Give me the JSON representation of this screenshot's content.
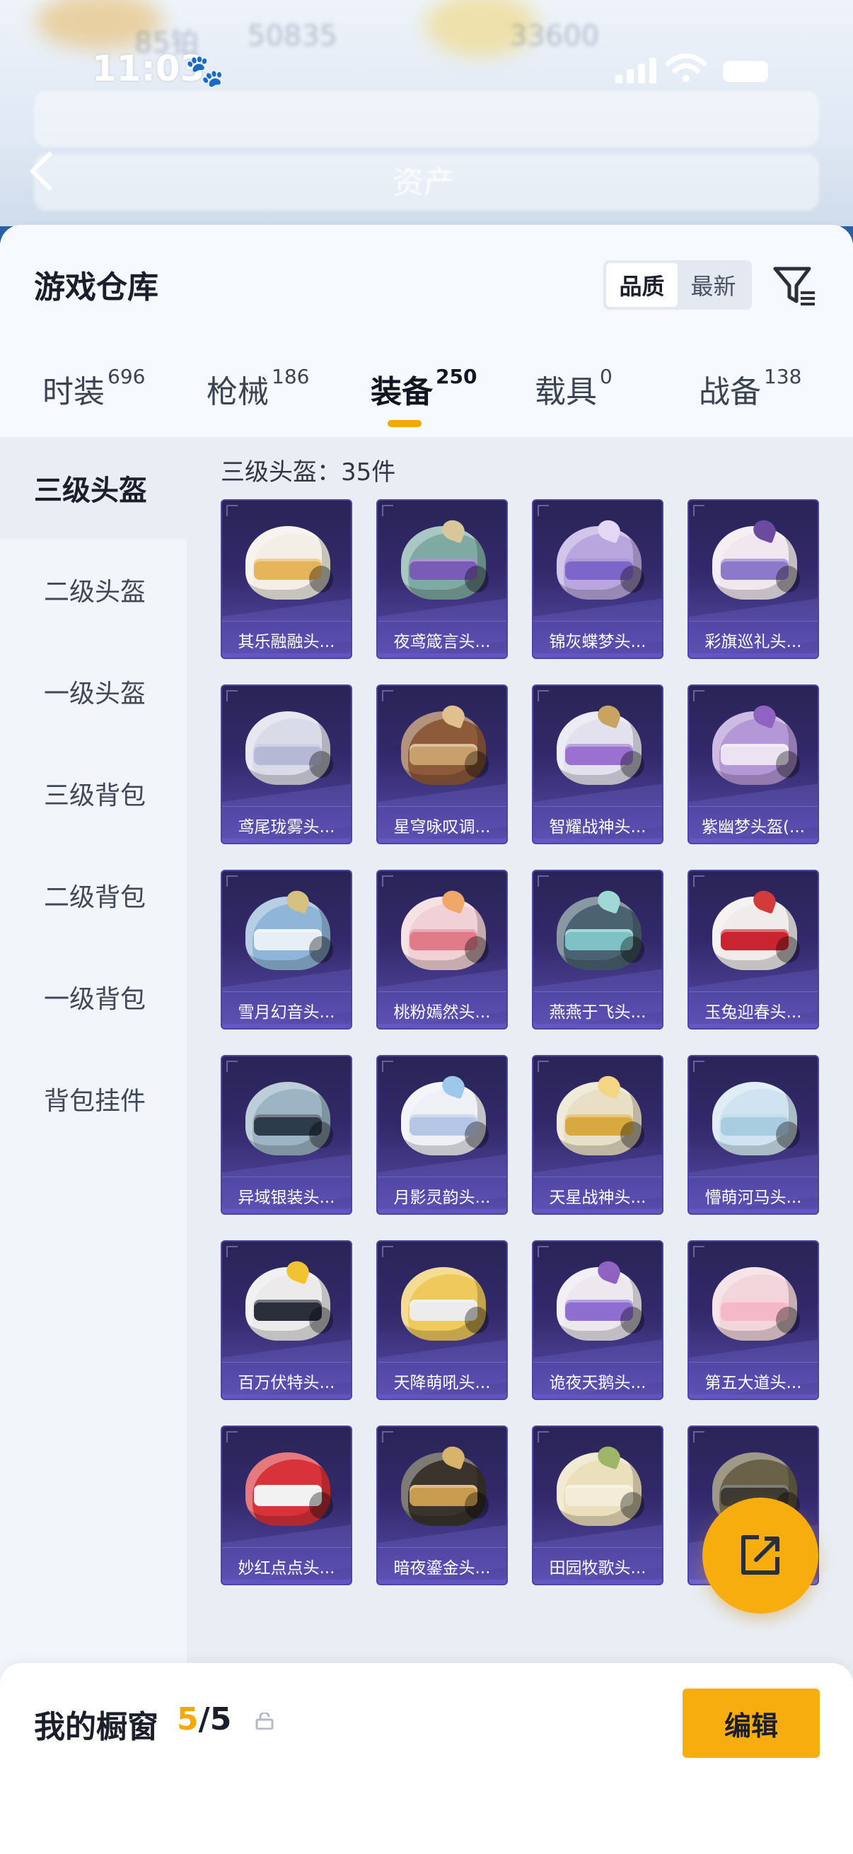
{
  "status_bar": {
    "time": "11:03"
  },
  "background_header": {
    "title": "资产",
    "blurred_values": [
      "85铂",
      "50835",
      "33600"
    ]
  },
  "page": {
    "title": "游戏仓库"
  },
  "sort_toggle": {
    "options": [
      "品质",
      "最新"
    ],
    "selected": "品质"
  },
  "category_tabs": [
    {
      "label": "时装",
      "count": "696",
      "active": false
    },
    {
      "label": "枪械",
      "count": "186",
      "active": false
    },
    {
      "label": "装备",
      "count": "250",
      "active": true
    },
    {
      "label": "载具",
      "count": "0",
      "active": false
    },
    {
      "label": "战备",
      "count": "138",
      "active": false
    }
  ],
  "sidebar": {
    "items": [
      {
        "label": "三级头盔",
        "active": true
      },
      {
        "label": "二级头盔",
        "active": false
      },
      {
        "label": "一级头盔",
        "active": false
      },
      {
        "label": "三级背包",
        "active": false
      },
      {
        "label": "二级背包",
        "active": false
      },
      {
        "label": "一级背包",
        "active": false
      },
      {
        "label": "背包挂件",
        "active": false
      }
    ]
  },
  "content": {
    "count_label": "三级头盔：35件"
  },
  "items": [
    {
      "name": "其乐融融头...",
      "color": "#f3efe6",
      "visor": "#e6b55a",
      "deco": ""
    },
    {
      "name": "夜鸢箴言头...",
      "color": "#7fa9a3",
      "visor": "#7a5cb8",
      "deco": "#d8c79a"
    },
    {
      "name": "锦灰蝶梦头...",
      "color": "#b9a6de",
      "visor": "#7c66c9",
      "deco": "#e3d7f5"
    },
    {
      "name": "彩旗巡礼头...",
      "color": "#f0e7ef",
      "visor": "#8a7ac9",
      "deco": "#6c4aa0"
    },
    {
      "name": "鸢尾珑雾头...",
      "color": "#d9dbe8",
      "visor": "#b5b9d6",
      "deco": ""
    },
    {
      "name": "星穹咏叹调...",
      "color": "#8d5a3a",
      "visor": "#c9a06b",
      "deco": "#e1c08c"
    },
    {
      "name": "智耀战神头...",
      "color": "#e3e1ee",
      "visor": "#9a70d0",
      "deco": "#c9a460"
    },
    {
      "name": "紫幽梦头盔(...",
      "color": "#b497d6",
      "visor": "#ece2f2",
      "deco": "#8f62c4"
    },
    {
      "name": "雪月幻音头...",
      "color": "#8fb6d8",
      "visor": "#e7eef6",
      "deco": "#d6c27e"
    },
    {
      "name": "桃粉嫣然头...",
      "color": "#f2d1d6",
      "visor": "#e07b8a",
      "deco": "#f0a86a"
    },
    {
      "name": "燕燕于飞头...",
      "color": "#4a6272",
      "visor": "#7fc2c6",
      "deco": "#9fd8d5"
    },
    {
      "name": "玉兔迎春头...",
      "color": "#f1ecec",
      "visor": "#c9242f",
      "deco": "#d33a3a"
    },
    {
      "name": "异域银装头...",
      "color": "#9cb4c4",
      "visor": "#2d3b4a",
      "deco": ""
    },
    {
      "name": "月影灵韵头...",
      "color": "#eef0f6",
      "visor": "#b6c7e6",
      "deco": "#9cc8ea"
    },
    {
      "name": "天星战神头...",
      "color": "#e9dfc6",
      "visor": "#d7a93e",
      "deco": "#f2d684"
    },
    {
      "name": "懵萌河马头...",
      "color": "#cfe4f0",
      "visor": "#a9cde0",
      "deco": ""
    },
    {
      "name": "百万伏特头...",
      "color": "#eceaea",
      "visor": "#2b2f3c",
      "deco": "#f1c232"
    },
    {
      "name": "天降萌吼头...",
      "color": "#f0c95c",
      "visor": "#ececec",
      "deco": ""
    },
    {
      "name": "诡夜天鹅头...",
      "color": "#ece8ee",
      "visor": "#8e6ed0",
      "deco": "#8f62c4"
    },
    {
      "name": "第五大道头...",
      "color": "#f2d6dc",
      "visor": "#f4b8c8",
      "deco": ""
    },
    {
      "name": "妙红点点头...",
      "color": "#d8323a",
      "visor": "#f2f2f2",
      "deco": ""
    },
    {
      "name": "暗夜鎏金头...",
      "color": "#3a342c",
      "visor": "#c99d50",
      "deco": "#d8b46a"
    },
    {
      "name": "田园牧歌头...",
      "color": "#ecdfbb",
      "visor": "#f4ecd8",
      "deco": "#9eb56a"
    },
    {
      "name": "",
      "color": "#6a6248",
      "visor": "#3c3a32",
      "deco": ""
    }
  ],
  "bottom_bar": {
    "label": "我的橱窗",
    "current": "5",
    "separator": "/",
    "total": "5",
    "edit_label": "编辑"
  },
  "colors": {
    "accent": "#f8ad0e",
    "card_bg": "#33296b"
  },
  "icons": [
    "back-arrow-icon",
    "filter-icon",
    "share-icon",
    "lock-icon",
    "paw-icon",
    "signal-icon",
    "wifi-icon",
    "battery-icon"
  ]
}
